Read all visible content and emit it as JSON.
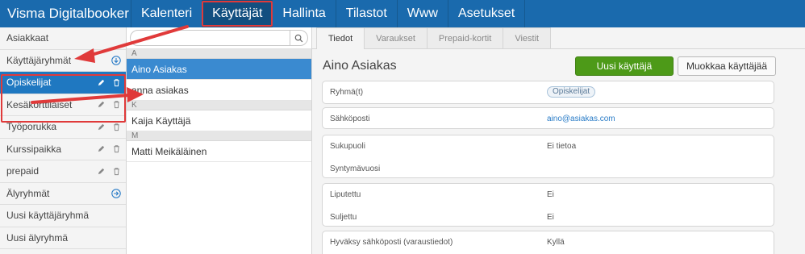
{
  "app": {
    "title": "Visma Digitalbooker"
  },
  "nav": {
    "items": [
      {
        "label": "Kalenteri"
      },
      {
        "label": "Käyttäjät"
      },
      {
        "label": "Hallinta"
      },
      {
        "label": "Tilastot"
      },
      {
        "label": "Www"
      },
      {
        "label": "Asetukset"
      }
    ],
    "active_index": 1
  },
  "sidebar": {
    "items": [
      {
        "label": "Asiakkaat"
      },
      {
        "label": "Käyttäjäryhmät"
      },
      {
        "label": "Opiskelijat"
      },
      {
        "label": "Kesäkorttilaiset"
      },
      {
        "label": "Työporukka"
      },
      {
        "label": "Kurssipaikka"
      },
      {
        "label": "prepaid"
      },
      {
        "label": "Älyryhmät"
      },
      {
        "label": "Uusi käyttäjäryhmä"
      },
      {
        "label": "Uusi älyryhmä"
      }
    ],
    "selected": "Opiskelijat"
  },
  "list": {
    "search_placeholder": "",
    "groups": [
      {
        "letter": "A",
        "users": [
          "Aino Asiakas",
          "anna asiakas"
        ]
      },
      {
        "letter": "K",
        "users": [
          "Kaija Käyttäjä"
        ]
      },
      {
        "letter": "M",
        "users": [
          "Matti Meikäläinen"
        ]
      }
    ],
    "selected": "Aino Asiakas"
  },
  "details": {
    "tabs": [
      "Tiedot",
      "Varaukset",
      "Prepaid-kortit",
      "Viestit"
    ],
    "active_tab": "Tiedot",
    "user_name": "Aino Asiakas",
    "new_user_button": "Uusi käyttäjä",
    "edit_user_button": "Muokkaa käyttäjää",
    "fields": {
      "group_label": "Ryhmä(t)",
      "group_value": "Opiskelijat",
      "email_label": "Sähköposti",
      "email_value": "aino@asiakas.com",
      "gender_label": "Sukupuoli",
      "gender_value": "Ei tietoa",
      "birthyear_label": "Syntymävuosi",
      "birthyear_value": "",
      "liputettu_label": "Liputettu",
      "liputettu_value": "Ei",
      "suljettu_label": "Suljettu",
      "suljettu_value": "Ei",
      "accept_email_label": "Hyväksy sähköposti (varaustiedot)",
      "accept_email_value": "Kyllä"
    }
  },
  "colors": {
    "topbar": "#1a6aad",
    "selected_blue": "#1f78c1",
    "green_button": "#4d9a18",
    "annotation_red": "#e03a3a"
  }
}
